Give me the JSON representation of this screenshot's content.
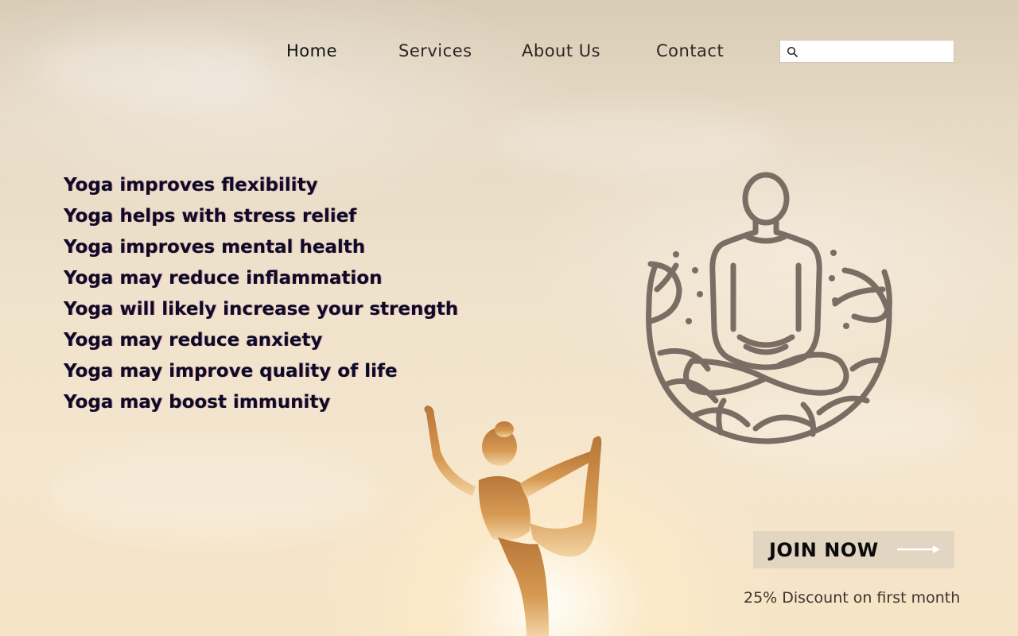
{
  "nav": {
    "items": [
      {
        "label": "Home"
      },
      {
        "label": "Services"
      },
      {
        "label": "About Us"
      },
      {
        "label": "Contact"
      }
    ],
    "search": {
      "value": "",
      "placeholder": ""
    }
  },
  "benefits": [
    "Yoga improves flexibility",
    "Yoga helps with stress relief",
    "Yoga improves mental health",
    "Yoga may reduce inflammation",
    "Yoga will likely increase your strength",
    "Yoga may reduce anxiety",
    "Yoga may improve quality of life",
    "Yoga may boost immunity"
  ],
  "cta": {
    "label": "JOIN NOW",
    "discount": "25% Discount on first month"
  },
  "icons": {
    "search": "search-icon",
    "emblem": "meditation-emblem-icon",
    "arrow": "arrow-right-icon"
  },
  "colors": {
    "emblem_stroke": "#7a6d64",
    "cta_bg": "#e2d5c2",
    "text_dark": "#0c0a26"
  }
}
